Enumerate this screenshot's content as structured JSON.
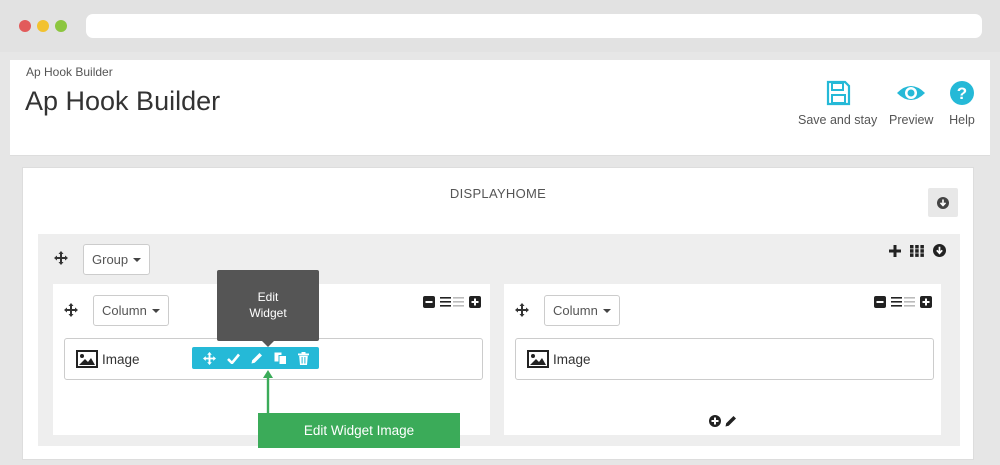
{
  "header": {
    "breadcrumb": "Ap Hook Builder",
    "title": "Ap Hook Builder",
    "toolbar": {
      "save_label": "Save and stay",
      "preview_label": "Preview",
      "help_label": "Help"
    }
  },
  "hook": {
    "name": "DISPLAYHOME"
  },
  "group": {
    "select_label": "Group"
  },
  "columns": [
    {
      "select_label": "Column",
      "widget_label": "Image"
    },
    {
      "select_label": "Column",
      "widget_label": "Image"
    }
  ],
  "tooltip": {
    "line1": "Edit",
    "line2": "Widget"
  },
  "callout": {
    "text": "Edit Widget Image"
  },
  "colors": {
    "accent": "#25b9d7",
    "callout": "#3bab59",
    "tooltip": "#555555"
  }
}
